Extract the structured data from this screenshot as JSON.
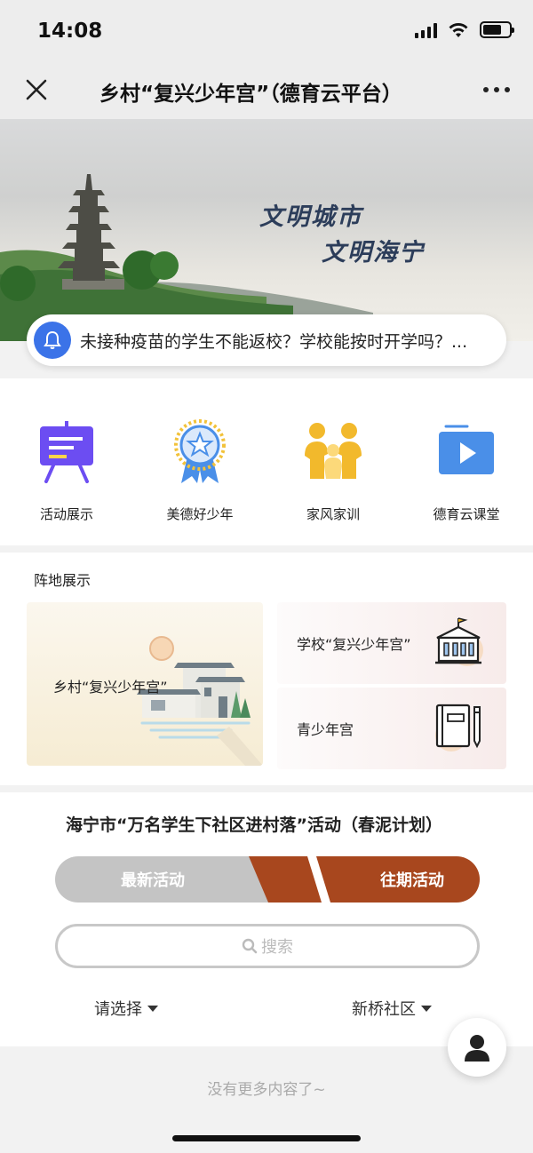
{
  "status_bar": {
    "time": "14:08"
  },
  "nav": {
    "title": "乡村“复兴少年宫”（德育云平台）"
  },
  "banner": {
    "line1": "文明城市",
    "line2": "文明海宁"
  },
  "notice": {
    "text": "未接种疫苗的学生不能返校？学校能按时开学吗？..."
  },
  "quick_entries": [
    {
      "label": "活动展示",
      "icon": "presentation-board-icon"
    },
    {
      "label": "美德好少年",
      "icon": "award-badge-icon"
    },
    {
      "label": "家风家训",
      "icon": "family-icon"
    },
    {
      "label": "德育云课堂",
      "icon": "video-play-icon"
    }
  ],
  "zhendi": {
    "title": "阵地展示",
    "big_card": {
      "label": "乡村“复兴少年宫”"
    },
    "small_cards": [
      {
        "label": "学校“复兴少年宫”",
        "icon": "school-building-icon"
      },
      {
        "label": "青少年宫",
        "icon": "notebook-pen-icon"
      }
    ]
  },
  "activity": {
    "title": "海宁市“万名学生下社区进村落”活动（春泥计划）",
    "tab_latest": "最新活动",
    "tab_past": "往期活动",
    "search_placeholder": "搜索",
    "filter_left": "请选择",
    "filter_right": "新桥社区"
  },
  "footer": {
    "text": "没有更多内容了~"
  },
  "colors": {
    "accent_brown": "#a8471e",
    "notice_blue": "#3b73e8",
    "icon_purple": "#6c4df2"
  }
}
